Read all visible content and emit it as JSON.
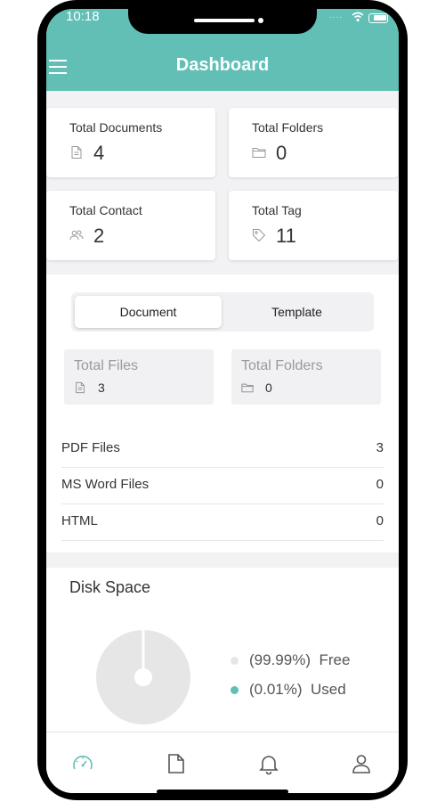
{
  "status_bar": {
    "time": "10:18",
    "signal_dots": "...."
  },
  "header": {
    "title": "Dashboard"
  },
  "stats": [
    {
      "label": "Total Documents",
      "value": "4",
      "icon": "document-icon"
    },
    {
      "label": "Total Folders",
      "value": "0",
      "icon": "folder-icon"
    },
    {
      "label": "Total Contact",
      "value": "2",
      "icon": "contacts-icon"
    },
    {
      "label": "Total Tag",
      "value": "11",
      "icon": "tag-icon"
    }
  ],
  "segment": {
    "tabs": [
      "Document",
      "Template"
    ],
    "active": "Document"
  },
  "files_summary": [
    {
      "label": "Total Files",
      "value": "3",
      "icon": "document-icon"
    },
    {
      "label": "Total Folders",
      "value": "0",
      "icon": "folder-icon"
    }
  ],
  "file_types": [
    {
      "label": "PDF Files",
      "value": "3"
    },
    {
      "label": "MS Word Files",
      "value": "0"
    },
    {
      "label": "HTML",
      "value": "0"
    }
  ],
  "disk_space": {
    "title": "Disk Space",
    "legend": [
      {
        "percent": "(99.99%)",
        "label": "Free",
        "color": "#e6e6e6"
      },
      {
        "percent": "(0.01%)",
        "label": "Used",
        "color": "#62bfb5"
      }
    ]
  },
  "tab_bar": [
    "dashboard-icon",
    "document-icon",
    "bell-icon",
    "user-icon"
  ],
  "colors": {
    "accent": "#62bfb5",
    "background": "#f2f2f4"
  }
}
